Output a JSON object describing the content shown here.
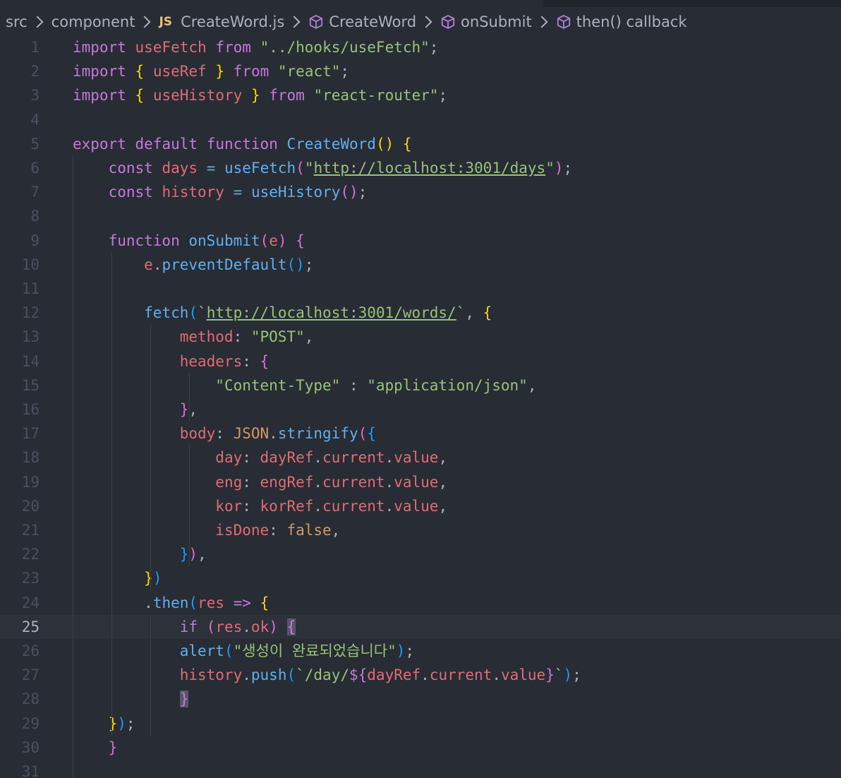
{
  "breadcrumb": {
    "items": [
      {
        "label": "src",
        "icon": null
      },
      {
        "label": "component",
        "icon": null
      },
      {
        "label": "CreateWord.js",
        "icon": "js-file-icon",
        "icon_text": "JS"
      },
      {
        "label": "CreateWord",
        "icon": "symbol-method-icon"
      },
      {
        "label": "onSubmit",
        "icon": "symbol-method-icon"
      },
      {
        "label": "then() callback",
        "icon": "symbol-method-icon"
      }
    ]
  },
  "editor": {
    "current_line": 25,
    "colors": {
      "background": "#282c34",
      "current_line": "#2c313a",
      "keyword": "#c678dd",
      "function": "#61afef",
      "string": "#98c379",
      "variable": "#e06c75",
      "number": "#d19a66",
      "bracket_gold": "#ffd700",
      "bracket_orchid": "#da70d6",
      "bracket_blue": "#179fff"
    },
    "lines": [
      {
        "n": "1",
        "tokens": [
          [
            "kw",
            "import"
          ],
          [
            "punc",
            " "
          ],
          [
            "var",
            "useFetch"
          ],
          [
            "punc",
            " "
          ],
          [
            "kw",
            "from"
          ],
          [
            "punc",
            " "
          ],
          [
            "str",
            "\"../hooks/useFetch\""
          ],
          [
            "punc",
            ";"
          ]
        ]
      },
      {
        "n": "2",
        "tokens": [
          [
            "kw",
            "import"
          ],
          [
            "punc",
            " "
          ],
          [
            "b1",
            "{"
          ],
          [
            "punc",
            " "
          ],
          [
            "var",
            "useRef"
          ],
          [
            "punc",
            " "
          ],
          [
            "b1",
            "}"
          ],
          [
            "punc",
            " "
          ],
          [
            "kw",
            "from"
          ],
          [
            "punc",
            " "
          ],
          [
            "str",
            "\"react\""
          ],
          [
            "punc",
            ";"
          ]
        ]
      },
      {
        "n": "3",
        "tokens": [
          [
            "kw",
            "import"
          ],
          [
            "punc",
            " "
          ],
          [
            "b1",
            "{"
          ],
          [
            "punc",
            " "
          ],
          [
            "var",
            "useHistory"
          ],
          [
            "punc",
            " "
          ],
          [
            "b1",
            "}"
          ],
          [
            "punc",
            " "
          ],
          [
            "kw",
            "from"
          ],
          [
            "punc",
            " "
          ],
          [
            "str",
            "\"react-router\""
          ],
          [
            "punc",
            ";"
          ]
        ]
      },
      {
        "n": "4",
        "tokens": []
      },
      {
        "n": "5",
        "tokens": [
          [
            "kw",
            "export"
          ],
          [
            "punc",
            " "
          ],
          [
            "kw",
            "default"
          ],
          [
            "punc",
            " "
          ],
          [
            "kw",
            "function"
          ],
          [
            "punc",
            " "
          ],
          [
            "fn",
            "CreateWord"
          ],
          [
            "b1",
            "()"
          ],
          [
            "punc",
            " "
          ],
          [
            "b1",
            "{"
          ]
        ]
      },
      {
        "n": "6",
        "tokens": [
          [
            "punc",
            "    "
          ],
          [
            "kw",
            "const"
          ],
          [
            "punc",
            " "
          ],
          [
            "var",
            "days"
          ],
          [
            "punc",
            " "
          ],
          [
            "op",
            "="
          ],
          [
            "punc",
            " "
          ],
          [
            "fn",
            "useFetch"
          ],
          [
            "b2",
            "("
          ],
          [
            "str",
            "\""
          ],
          [
            "str url",
            "http://localhost:3001/days"
          ],
          [
            "str",
            "\""
          ],
          [
            "b2",
            ")"
          ],
          [
            "punc",
            ";"
          ]
        ]
      },
      {
        "n": "7",
        "tokens": [
          [
            "punc",
            "    "
          ],
          [
            "kw",
            "const"
          ],
          [
            "punc",
            " "
          ],
          [
            "var",
            "history"
          ],
          [
            "punc",
            " "
          ],
          [
            "op",
            "="
          ],
          [
            "punc",
            " "
          ],
          [
            "fn",
            "useHistory"
          ],
          [
            "b2",
            "()"
          ],
          [
            "punc",
            ";"
          ]
        ]
      },
      {
        "n": "8",
        "tokens": []
      },
      {
        "n": "9",
        "tokens": [
          [
            "punc",
            "    "
          ],
          [
            "kw",
            "function"
          ],
          [
            "punc",
            " "
          ],
          [
            "fn",
            "onSubmit"
          ],
          [
            "b2",
            "("
          ],
          [
            "var",
            "e"
          ],
          [
            "b2",
            ")"
          ],
          [
            "punc",
            " "
          ],
          [
            "b2",
            "{"
          ]
        ]
      },
      {
        "n": "10",
        "tokens": [
          [
            "punc",
            "        "
          ],
          [
            "var",
            "e"
          ],
          [
            "punc",
            "."
          ],
          [
            "fn",
            "preventDefault"
          ],
          [
            "b3",
            "()"
          ],
          [
            "punc",
            ";"
          ]
        ]
      },
      {
        "n": "11",
        "tokens": []
      },
      {
        "n": "12",
        "tokens": [
          [
            "punc",
            "        "
          ],
          [
            "fn",
            "fetch"
          ],
          [
            "b3",
            "("
          ],
          [
            "str",
            "`"
          ],
          [
            "str url",
            "http://localhost:3001/words/"
          ],
          [
            "str",
            "`"
          ],
          [
            "punc",
            ", "
          ],
          [
            "b1",
            "{"
          ]
        ]
      },
      {
        "n": "13",
        "tokens": [
          [
            "punc",
            "            "
          ],
          [
            "prop",
            "method"
          ],
          [
            "punc",
            ": "
          ],
          [
            "str",
            "\"POST\""
          ],
          [
            "punc",
            ","
          ]
        ]
      },
      {
        "n": "14",
        "tokens": [
          [
            "punc",
            "            "
          ],
          [
            "prop",
            "headers"
          ],
          [
            "punc",
            ": "
          ],
          [
            "b2",
            "{"
          ]
        ]
      },
      {
        "n": "15",
        "tokens": [
          [
            "punc",
            "                "
          ],
          [
            "str",
            "\"Content-Type\""
          ],
          [
            "punc",
            " : "
          ],
          [
            "str",
            "\"application/json\""
          ],
          [
            "punc",
            ","
          ]
        ]
      },
      {
        "n": "16",
        "tokens": [
          [
            "punc",
            "            "
          ],
          [
            "b2",
            "}"
          ],
          [
            "punc",
            ","
          ]
        ]
      },
      {
        "n": "17",
        "tokens": [
          [
            "punc",
            "            "
          ],
          [
            "prop",
            "body"
          ],
          [
            "punc",
            ": "
          ],
          [
            "const",
            "JSON"
          ],
          [
            "punc",
            "."
          ],
          [
            "fn",
            "stringify"
          ],
          [
            "b2",
            "("
          ],
          [
            "b3",
            "{"
          ]
        ]
      },
      {
        "n": "18",
        "tokens": [
          [
            "punc",
            "                "
          ],
          [
            "prop",
            "day"
          ],
          [
            "punc",
            ": "
          ],
          [
            "var",
            "dayRef"
          ],
          [
            "punc",
            "."
          ],
          [
            "var",
            "current"
          ],
          [
            "punc",
            "."
          ],
          [
            "var",
            "value"
          ],
          [
            "punc",
            ","
          ]
        ]
      },
      {
        "n": "19",
        "tokens": [
          [
            "punc",
            "                "
          ],
          [
            "prop",
            "eng"
          ],
          [
            "punc",
            ": "
          ],
          [
            "var",
            "engRef"
          ],
          [
            "punc",
            "."
          ],
          [
            "var",
            "current"
          ],
          [
            "punc",
            "."
          ],
          [
            "var",
            "value"
          ],
          [
            "punc",
            ","
          ]
        ]
      },
      {
        "n": "20",
        "tokens": [
          [
            "punc",
            "                "
          ],
          [
            "prop",
            "kor"
          ],
          [
            "punc",
            ": "
          ],
          [
            "var",
            "korRef"
          ],
          [
            "punc",
            "."
          ],
          [
            "var",
            "current"
          ],
          [
            "punc",
            "."
          ],
          [
            "var",
            "value"
          ],
          [
            "punc",
            ","
          ]
        ]
      },
      {
        "n": "21",
        "tokens": [
          [
            "punc",
            "                "
          ],
          [
            "prop",
            "isDone"
          ],
          [
            "punc",
            ": "
          ],
          [
            "const",
            "false"
          ],
          [
            "punc",
            ","
          ]
        ]
      },
      {
        "n": "22",
        "tokens": [
          [
            "punc",
            "            "
          ],
          [
            "b3",
            "}"
          ],
          [
            "b2",
            ")"
          ],
          [
            "punc",
            ","
          ]
        ]
      },
      {
        "n": "23",
        "tokens": [
          [
            "punc",
            "        "
          ],
          [
            "b1",
            "}"
          ],
          [
            "b3",
            ")"
          ]
        ]
      },
      {
        "n": "24",
        "tokens": [
          [
            "punc",
            "        "
          ],
          [
            "punc",
            "."
          ],
          [
            "fn",
            "then"
          ],
          [
            "b3",
            "("
          ],
          [
            "var",
            "res"
          ],
          [
            "punc",
            " "
          ],
          [
            "kw",
            "=>"
          ],
          [
            "punc",
            " "
          ],
          [
            "b1",
            "{"
          ]
        ]
      },
      {
        "n": "25",
        "tokens": [
          [
            "punc",
            "            "
          ],
          [
            "kw",
            "if"
          ],
          [
            "punc",
            " "
          ],
          [
            "b2",
            "("
          ],
          [
            "var",
            "res"
          ],
          [
            "punc",
            "."
          ],
          [
            "var",
            "ok"
          ],
          [
            "b2",
            ")"
          ],
          [
            "punc",
            " "
          ],
          [
            "b2 match-brace",
            "{"
          ]
        ]
      },
      {
        "n": "26",
        "tokens": [
          [
            "punc",
            "            "
          ],
          [
            "fn",
            "alert"
          ],
          [
            "b3",
            "("
          ],
          [
            "str",
            "\"생성이 완료되었습니다\""
          ],
          [
            "b3",
            ")"
          ],
          [
            "punc",
            ";"
          ]
        ]
      },
      {
        "n": "27",
        "tokens": [
          [
            "punc",
            "            "
          ],
          [
            "var",
            "history"
          ],
          [
            "punc",
            "."
          ],
          [
            "fn",
            "push"
          ],
          [
            "b3",
            "("
          ],
          [
            "str",
            "`/day/"
          ],
          [
            "kw",
            "${"
          ],
          [
            "var",
            "dayRef"
          ],
          [
            "punc",
            "."
          ],
          [
            "var",
            "current"
          ],
          [
            "punc",
            "."
          ],
          [
            "var",
            "value"
          ],
          [
            "kw",
            "}"
          ],
          [
            "str",
            "`"
          ],
          [
            "b3",
            ")"
          ],
          [
            "punc",
            ";"
          ]
        ]
      },
      {
        "n": "28",
        "tokens": [
          [
            "punc",
            "            "
          ],
          [
            "b2 match-brace",
            "}"
          ]
        ]
      },
      {
        "n": "29",
        "tokens": [
          [
            "punc",
            "    "
          ],
          [
            "b1",
            "}"
          ],
          [
            "b3",
            ")"
          ],
          [
            "punc",
            ";"
          ]
        ]
      },
      {
        "n": "30",
        "tokens": [
          [
            "punc",
            "    "
          ],
          [
            "b2",
            "}"
          ]
        ]
      },
      {
        "n": "31",
        "tokens": []
      }
    ]
  }
}
